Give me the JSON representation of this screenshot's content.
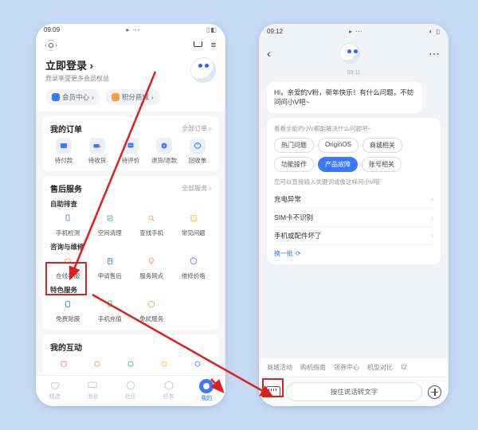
{
  "left": {
    "status_time": "09:09",
    "login_title": "立即登录",
    "login_sub": "登录享受更多会员权益",
    "chip_member": "会员中心",
    "chip_points": "积分商城",
    "orders": {
      "title": "我的订单",
      "more": "全部订单 ›",
      "items": [
        "待付款",
        "待收货",
        "待评价",
        "退货/退款",
        "回收单"
      ]
    },
    "aftersale": {
      "title": "售后服务",
      "more": "全部服务 ›",
      "g1_title": "自助排查",
      "g1": [
        "手机检测",
        "空间清理",
        "查找手机",
        "常见问题"
      ],
      "g2_title": "咨询与维修",
      "g2": [
        "在线客服",
        "申请售后",
        "服务网点",
        "维修价格"
      ],
      "g3_title": "特色服务",
      "g3": [
        "免费贴膜",
        "手机充值",
        "免扰服务"
      ]
    },
    "interact_title": "我的互动",
    "nav": [
      "精选",
      "消息",
      "社区",
      "任务",
      "我的"
    ]
  },
  "right": {
    "status_time": "09:12",
    "chat_time": "09:11",
    "greeting": "Hi，亲爱的V粉，新年快乐！有什么问题，不妨问问小V吧~",
    "card_hint": "看看全能的小V都能解决什么问题吧~",
    "pills": [
      "热门问题",
      "OriginOS",
      "商城相关",
      "功能操作",
      "产品故障",
      "账号相关"
    ],
    "sub_hint": "您可以直接输入关键词或像这样问小V哦",
    "faq": [
      "充电异常",
      "SIM卡不识别",
      "手机或配件坏了"
    ],
    "refresh": "换一批",
    "quick": [
      "商城活动",
      "购机指南",
      "领券中心",
      "机型对比",
      "以"
    ],
    "voice_placeholder": "按住说话转文字"
  }
}
